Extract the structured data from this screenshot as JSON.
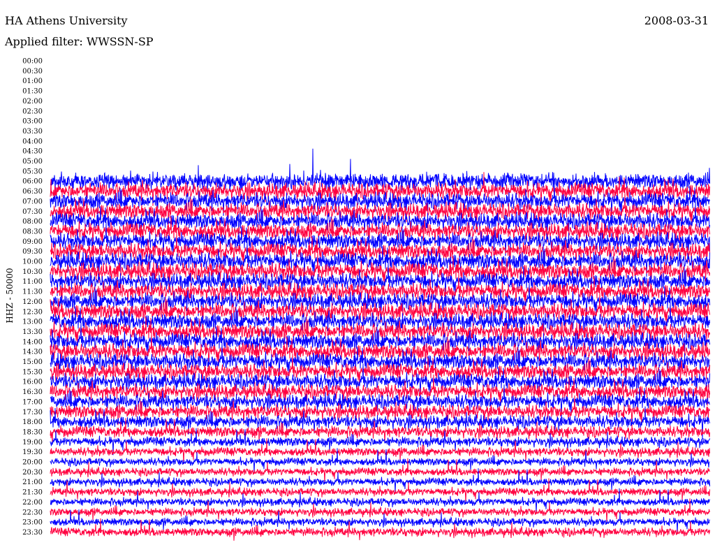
{
  "header": {
    "station": "HA Athens University",
    "filter": "Applied filter: WWSSN-SP",
    "date": "2008-03-31"
  },
  "chart_data": {
    "type": "line",
    "subtype": "helicorder",
    "title": "HA Athens University",
    "ylabel": "HHZ - 50000",
    "row_minutes": 30,
    "row_labels": [
      "00:00",
      "00:30",
      "01:00",
      "01:30",
      "02:00",
      "02:30",
      "03:00",
      "03:30",
      "04:00",
      "04:30",
      "05:00",
      "05:30",
      "06:00",
      "06:30",
      "07:00",
      "07:30",
      "08:00",
      "08:30",
      "09:00",
      "09:30",
      "10:00",
      "10:30",
      "11:00",
      "11:30",
      "12:00",
      "12:30",
      "13:00",
      "13:30",
      "14:00",
      "14:30",
      "15:00",
      "15:30",
      "16:00",
      "16:30",
      "17:00",
      "17:30",
      "18:00",
      "18:30",
      "19:00",
      "19:30",
      "20:00",
      "20:30",
      "21:00",
      "21:30",
      "22:00",
      "22:30",
      "23:00",
      "23:30"
    ],
    "first_data_row": "06:00",
    "relative_noise_level": [
      0,
      0,
      0,
      0,
      0,
      0,
      0,
      0,
      0,
      0,
      0,
      0,
      1.0,
      1.0,
      1.0,
      1.0,
      1.0,
      1.0,
      1.0,
      1.0,
      1.05,
      1.05,
      1.0,
      1.0,
      1.0,
      1.0,
      1.0,
      1.0,
      1.0,
      1.0,
      1.0,
      0.95,
      0.95,
      0.9,
      0.9,
      0.85,
      0.8,
      0.7,
      0.6,
      0.55,
      0.5,
      0.5,
      0.5,
      0.5,
      0.5,
      0.5,
      0.5,
      0.55
    ],
    "colors": {
      "even_rows": "#0000ff",
      "odd_rows": "#ff0040"
    },
    "grid": false
  }
}
